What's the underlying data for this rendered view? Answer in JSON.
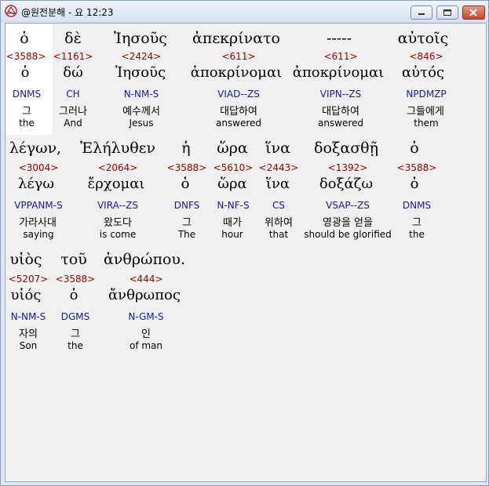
{
  "window": {
    "title": "@원전분해 - 요 12:23"
  },
  "verse": {
    "lines": [
      {
        "words": [
          {
            "greek": "ὁ",
            "strongs": "<3588>",
            "lemma": "ὁ",
            "parse": "DNMS",
            "korean": "그",
            "english": "the"
          },
          {
            "greek": "δὲ",
            "strongs": "<1161>",
            "lemma": "δώ",
            "parse": "CH",
            "korean": "그러나",
            "english": "And"
          },
          {
            "greek": "Ἰησοῦς",
            "strongs": "<2424>",
            "lemma": "Ἰησοῦς",
            "parse": "N-NM-S",
            "korean": "예수께서",
            "english": "Jesus"
          },
          {
            "greek": "ἀπεκρίνατο",
            "strongs": "<611>",
            "lemma": "ἀποκρίνομαι",
            "parse": "VIAD--ZS",
            "korean": "대답하여",
            "english": "answered"
          },
          {
            "greek": "-----",
            "strongs": "<611>",
            "lemma": "ἀποκρίνομαι",
            "parse": "VIPN--ZS",
            "korean": "대답하여",
            "english": "answered"
          },
          {
            "greek": "αὐτοῖς",
            "strongs": "<846>",
            "lemma": "αὐτός",
            "parse": "NPDMZP",
            "korean": "그들에게",
            "english": "them"
          }
        ]
      },
      {
        "words": [
          {
            "greek": "λέγων,",
            "strongs": "<3004>",
            "lemma": "λέγω",
            "parse": "VPPANM-S",
            "korean": "가라사대",
            "english": "saying"
          },
          {
            "greek": "Ἐλήλυθεν",
            "strongs": "<2064>",
            "lemma": "ἔρχομαι",
            "parse": "VIRA--ZS",
            "korean": "왔도다",
            "english": "is come"
          },
          {
            "greek": "ἡ",
            "strongs": "<3588>",
            "lemma": "ὁ",
            "parse": "DNFS",
            "korean": "그",
            "english": "The"
          },
          {
            "greek": "ὥρα",
            "strongs": "<5610>",
            "lemma": "ὥρα",
            "parse": "N-NF-S",
            "korean": "때가",
            "english": "hour"
          },
          {
            "greek": "ἵνα",
            "strongs": "<2443>",
            "lemma": "ἵνα",
            "parse": "CS",
            "korean": "위하여",
            "english": "that"
          },
          {
            "greek": "δοξασθῇ",
            "strongs": "<1392>",
            "lemma": "δοξάζω",
            "parse": "VSAP--ZS",
            "korean": "영광을 얻을",
            "english": "should be glorified"
          },
          {
            "greek": "ὁ",
            "strongs": "<3588>",
            "lemma": "ὁ",
            "parse": "DNMS",
            "korean": "그",
            "english": "the"
          }
        ]
      },
      {
        "words": [
          {
            "greek": "υἱὸς",
            "strongs": "<5207>",
            "lemma": "υἱός",
            "parse": "N-NM-S",
            "korean": "자의",
            "english": "Son"
          },
          {
            "greek": "τοῦ",
            "strongs": "<3588>",
            "lemma": "ὁ",
            "parse": "DGMS",
            "korean": "그",
            "english": "the"
          },
          {
            "greek": "ἀνθρώπου.",
            "strongs": "<444>",
            "lemma": "ἄνθρωπος",
            "parse": "N-GM-S",
            "korean": "인",
            "english": "of man"
          }
        ]
      }
    ]
  }
}
